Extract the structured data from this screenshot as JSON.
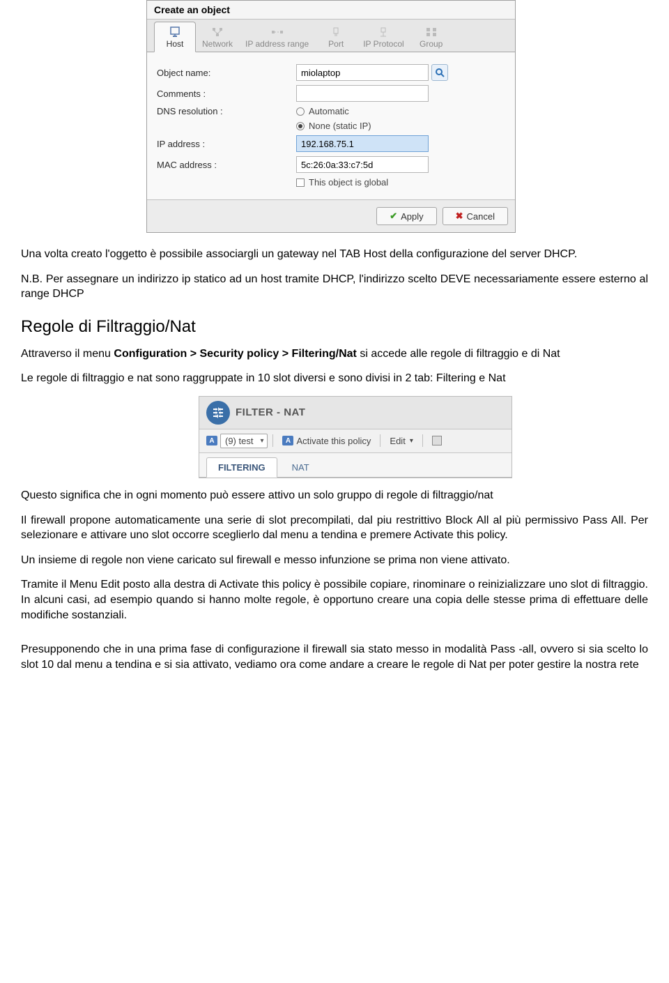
{
  "dialog1": {
    "title": "Create an object",
    "tabs": [
      "Host",
      "Network",
      "IP address range",
      "Port",
      "IP Protocol",
      "Group"
    ],
    "labels": {
      "object_name": "Object name:",
      "comments": "Comments :",
      "dns_resolution": "DNS resolution :",
      "ip_address": "IP address :",
      "mac_address": "MAC address :"
    },
    "values": {
      "object_name": "miolaptop",
      "comments": "",
      "ip_address": "192.168.75.1",
      "mac_address": "5c:26:0a:33:c7:5d"
    },
    "radio_opts": {
      "automatic": "Automatic",
      "none": "None (static IP)"
    },
    "checkbox_global": "This object is global",
    "buttons": {
      "apply": "Apply",
      "cancel": "Cancel"
    }
  },
  "text": {
    "p1a": "Una volta creato l'oggetto è possibile associargli un gateway nel TAB Host della configurazione del server DHCP.",
    "p1b": "N.B. Per assegnare un indirizzo ip statico ad un host tramite DHCP, l'indirizzo scelto DEVE necessariamente essere esterno al range DHCP",
    "h2": "Regole di Filtraggio/Nat",
    "p2a": "Attraverso il menu ",
    "p2b": "Configuration > Security policy > Filtering/Nat",
    "p2c": " si accede alle regole di filtraggio e di Nat",
    "p3": "Le regole di filtraggio e nat sono raggruppate in 10 slot diversi e sono divisi in 2 tab: Filtering e Nat",
    "p4": "Questo significa che in ogni momento può essere attivo un solo gruppo di regole di filtraggio/nat",
    "p5": "Il firewall propone automaticamente una serie di slot precompilati, dal piu restrittivo Block All al più permissivo Pass All. Per selezionare e attivare uno slot occorre sceglierlo dal menu a tendina e premere Activate this policy.",
    "p6": "Un insieme di regole non viene caricato sul firewall e messo infunzione se prima non viene attivato.",
    "p7": "Tramite il Menu Edit posto alla destra di Activate this policy è possibile copiare, rinominare o reinizializzare uno slot di filtraggio. In alcuni casi, ad esempio quando si hanno molte regole, è opportuno creare una copia delle stesse prima di effettuare delle modifiche sostanziali.",
    "p8": "Presupponendo che in una prima fase di configurazione il firewall sia stato messo in modalità Pass -all, ovvero si sia scelto lo slot 10 dal menu a tendina e si sia attivato, vediamo ora come andare a creare le regole di Nat per poter gestire la nostra rete"
  },
  "panel2": {
    "title": "FILTER - NAT",
    "slot": "(9) test",
    "activate": "Activate this policy",
    "edit": "Edit",
    "tabs": {
      "filtering": "FILTERING",
      "nat": "NAT"
    }
  }
}
